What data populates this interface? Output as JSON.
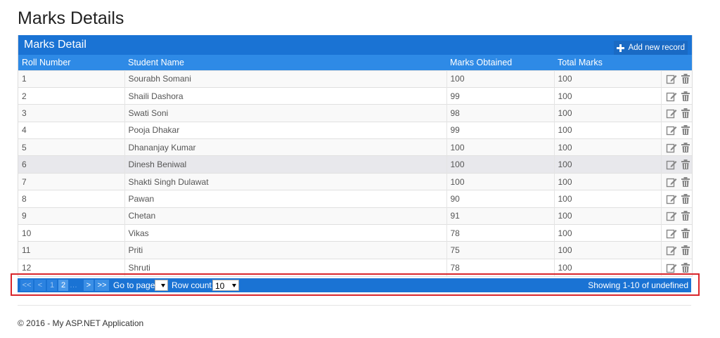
{
  "page": {
    "title": "Marks Details"
  },
  "grid": {
    "caption": "Marks Detail",
    "add_label": "Add new record",
    "columns": [
      "Roll Number",
      "Student Name",
      "Marks Obtained",
      "Total Marks"
    ],
    "rows": [
      [
        "1",
        "Sourabh Somani",
        "100",
        "100"
      ],
      [
        "2",
        "Shaili Dashora",
        "99",
        "100"
      ],
      [
        "3",
        "Swati Soni",
        "98",
        "100"
      ],
      [
        "4",
        "Pooja Dhakar",
        "99",
        "100"
      ],
      [
        "5",
        "Dhananjay Kumar",
        "100",
        "100"
      ],
      [
        "6",
        "Dinesh Beniwal",
        "100",
        "100"
      ],
      [
        "7",
        "Shakti Singh Dulawat",
        "100",
        "100"
      ],
      [
        "8",
        "Pawan",
        "90",
        "100"
      ],
      [
        "9",
        "Chetan",
        "91",
        "100"
      ],
      [
        "10",
        "Vikas",
        "78",
        "100"
      ],
      [
        "11",
        "Priti",
        "75",
        "100"
      ],
      [
        "12",
        "Shruti",
        "78",
        "100"
      ]
    ],
    "row_icons": [
      "edit-icon",
      "trash-icon"
    ]
  },
  "pager": {
    "first": "<<",
    "prev": "<",
    "page1": "1",
    "page2": "2",
    "dots": "…",
    "next": ">",
    "last": ">>",
    "goto_label": "Go to page:",
    "goto_value": "",
    "rowcount_label": "Row count:",
    "rowcount_value": "10",
    "showing": "Showing 1-10 of undefined"
  },
  "footer": {
    "text": "© 2016 - My ASP.NET Application"
  },
  "colors": {
    "header": "#1a73d4",
    "column_header": "#2e8ae6",
    "highlight_box": "#d9262c"
  }
}
